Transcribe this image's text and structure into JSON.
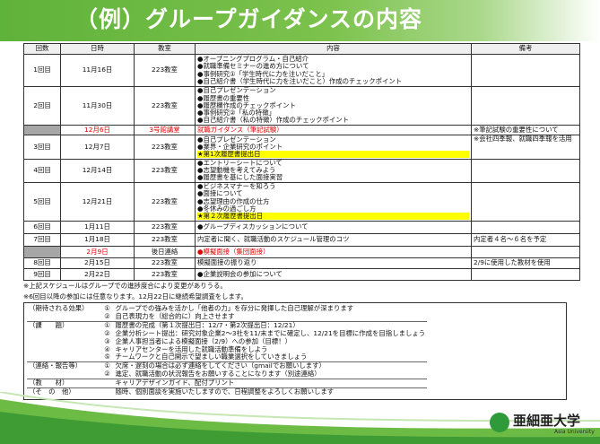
{
  "title": "（例）グループガイダンスの内容",
  "table": {
    "headers": [
      "回数",
      "日時",
      "教室",
      "内容",
      "備考"
    ],
    "rows": [
      {
        "kai": "1回目",
        "date": "11月16日",
        "room": "223教室",
        "content": [
          "●オープニングプログラム・自己紹介",
          "●就職準備セミナーの進め方について",
          "●事例研究①「学生時代に力を注いだこと」",
          "●自己紹介書（学生時代に力を注いだこと）作成のチェックポイント"
        ],
        "note": ""
      },
      {
        "kai": "2回目",
        "date": "11月30日",
        "room": "223教室",
        "content": [
          "●自己プレゼンテーション",
          "●履歴書の重要性",
          "●履歴欄作成のチェックポイント",
          "●事例研究②「私の特徴」",
          "●自己紹介書（私の特徴）作成のチェックポイント"
        ],
        "note": ""
      },
      {
        "kai": "",
        "date": "12月6日",
        "room": "3号館講堂",
        "content": [
          "就職ガイダンス（筆記試験）"
        ],
        "note": "※筆記試験の重要性について"
      },
      {
        "kai": "3回目",
        "date": "12月7日",
        "room": "223教室",
        "content": [
          "●自己プレゼンテーション",
          "●業界・企業研究のポイント",
          "★第1次履歴書提出日"
        ],
        "note": "※会社四季報、就職四季報を活用"
      },
      {
        "kai": "4回目",
        "date": "12月14日",
        "room": "223教室",
        "content": [
          "●エントリーシートについて",
          "●志望動機を考えてみよう",
          "●履歴書を基にした面接実習"
        ],
        "note": ""
      },
      {
        "kai": "5回目",
        "date": "12月21日",
        "room": "223教室",
        "content": [
          "●ビジネスマナーを知ろう",
          "●面接について",
          "●志望理由の作成の仕方",
          "●冬休みの過ごし方",
          "★第２次履歴書提出日"
        ],
        "note": ""
      },
      {
        "kai": "6回目",
        "date": "1月11日",
        "room": "223教室",
        "content": [
          "●グループディスカッションについて"
        ],
        "note": ""
      },
      {
        "kai": "7回目",
        "date": "1月18日",
        "room": "223教室",
        "content": [
          "内定者に聞く、就職活動のスケジュール管理のコツ"
        ],
        "note": "内定者４名～６名を予定"
      },
      {
        "kai": "",
        "date": "2月9日",
        "room": "後日連絡",
        "content": [
          "●模擬面接（集団面接）"
        ],
        "note": ""
      },
      {
        "kai": "8回目",
        "date": "2月15日",
        "room": "223教室",
        "content": [
          "模擬面接の振り返り"
        ],
        "note": "2/9に使用した教材を使用"
      },
      {
        "kai": "9回目",
        "date": "2月22日",
        "room": "223教室",
        "content": [
          "●企業説明会の参加について"
        ],
        "note": ""
      }
    ]
  },
  "notes": [
    "※上記スケジュールはグループでの進捗度合により変更がありうる。",
    "※6回目以降の参加には任意なります。12月22日に継続希望調査をします。"
  ],
  "info": [
    {
      "label": "（期待される効果）",
      "items": [
        {
          "n": "①",
          "text": "グループでの強みを活かし「他者の力」を存分に発揮した自己理解が深まります"
        },
        {
          "n": "②",
          "text": "自己表現力を（総合的に）向上させます"
        }
      ]
    },
    {
      "label": "（課　　題）",
      "items": [
        {
          "n": "①",
          "text": "履歴書の完成（第１次提出日：12/7・第2次提出日：12/21）"
        },
        {
          "n": "②",
          "text": "企業分析シート提出：研究対象企業2～3社を11/末までに確定し、12/21を目標に作成を目指しましょう"
        },
        {
          "n": "③",
          "text": "企業人事担当者による模擬面接（2/9）への参加（目標！）"
        },
        {
          "n": "④",
          "text": "キャリアセンターを活用した就職活動準備をしよう"
        },
        {
          "n": "⑤",
          "text": "チームワークと自己開示で望ましい職業選択をしていきましょう"
        }
      ]
    },
    {
      "label": "（連絡・報告等）",
      "items": [
        {
          "n": "①",
          "text": "欠席・遅刻の場合は必ず連絡をしてください（gmailでお願いします）"
        },
        {
          "n": "②",
          "text": "進定、就職活動の状況報告をお願いすることになります（別途連絡）"
        }
      ]
    },
    {
      "label": "（教　　材）",
      "items": [
        {
          "n": "",
          "text": "キャリアデザインガイド、配付プリント"
        }
      ]
    },
    {
      "label": "（そ　の　他）",
      "items": [
        {
          "n": "",
          "text": "随時、個別面談を実施いたしますので、日程調整をよろしくお願いします"
        }
      ]
    }
  ],
  "logo": {
    "name": "亜細亜大学",
    "sub": "Asia University"
  },
  "colors": {
    "banner_green": "#6cbb45",
    "highlight_yellow": "#ffff00",
    "special_red": "#e00000",
    "grey_cell": "#a6a6a6"
  }
}
